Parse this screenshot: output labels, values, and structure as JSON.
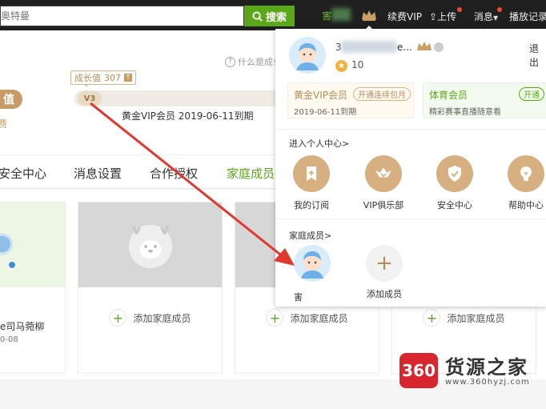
{
  "topbar": {
    "search_placeholder": "奥特曼",
    "search_button": "搜索",
    "user_text": "害",
    "renew_vip": "续费VIP",
    "upload": "上传",
    "messages": "消息",
    "play_history": "播放记录"
  },
  "account": {
    "help_text": "什么是成长值",
    "growth_label": "成长值",
    "growth_value": "307",
    "level_chip": "V3",
    "recharge_pill": "值",
    "renew_text": "费",
    "member_status": "黄金VIP会员  2019-06-11到期"
  },
  "tabs": [
    {
      "label": "安全中心"
    },
    {
      "label": "消息设置"
    },
    {
      "label": "合作授权"
    },
    {
      "label": "家庭成员"
    }
  ],
  "family_cards": {
    "self_name": "e司马菀柳",
    "self_date": "0-08",
    "add_label": "添加家庭成员"
  },
  "dropdown": {
    "name_prefix": "3",
    "name_suffix": "e...",
    "logout": "退出",
    "level": "10",
    "gold_vip": {
      "title": "黄金VIP会员",
      "pill": "开通连续包月",
      "subtitle": "2019-06-11到期"
    },
    "sports": {
      "title": "体育会员",
      "pill": "开通",
      "subtitle": "精彩赛事直播随意看"
    },
    "personal_center_title": "进入个人中心>",
    "entries": [
      {
        "label": "我的订阅",
        "icon": "subscription-icon"
      },
      {
        "label": "VIP俱乐部",
        "icon": "vip-club-icon"
      },
      {
        "label": "安全中心",
        "icon": "shield-check-icon"
      },
      {
        "label": "帮助中心",
        "icon": "lightbulb-icon"
      }
    ],
    "family_title": "家庭成员>",
    "member_name": "害",
    "add_member": "添加成员"
  },
  "watermark": {
    "badge": "360",
    "title": "货源之家",
    "url": "www.360hyzj.com"
  },
  "colors": {
    "brand_green": "#5aa818",
    "gold": "#c69b66",
    "annotation_red": "#e0382f"
  }
}
